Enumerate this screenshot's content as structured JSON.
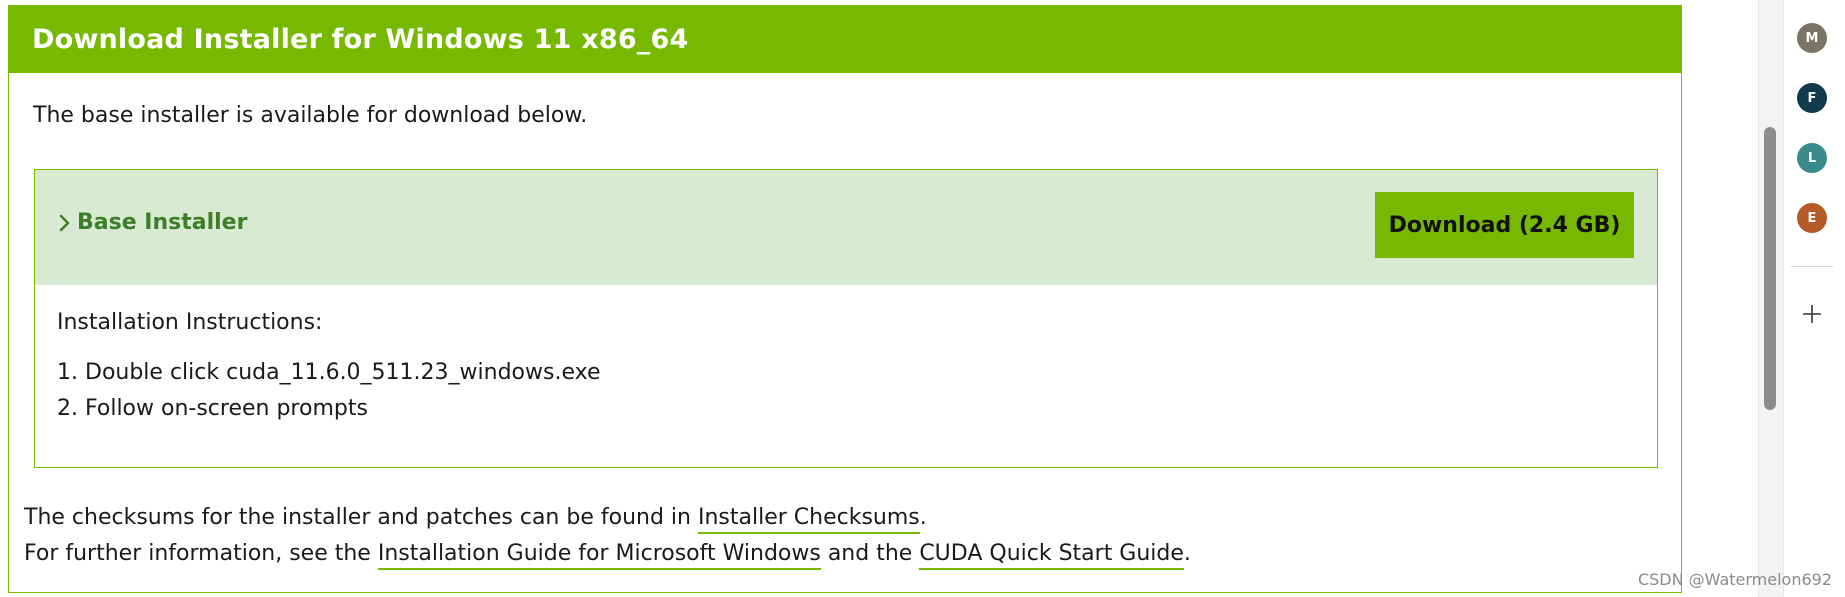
{
  "panel": {
    "title": "Download Installer for Windows 11 x86_64",
    "intro": "The base installer is available for download below."
  },
  "installer": {
    "label": "Base Installer",
    "download_label": "Download (2.4 GB)",
    "instructions_title": "Installation Instructions:",
    "steps": [
      "Double click cuda_11.6.0_511.23_windows.exe",
      "Follow on-screen prompts"
    ]
  },
  "footer": {
    "line1_prefix": "The checksums for the installer and patches can be found in ",
    "checksums_link": "Installer Checksums",
    "line1_suffix": ".",
    "line2_prefix": "For further information, see the ",
    "guide_link": "Installation Guide for Microsoft Windows",
    "line2_middle": " and the ",
    "quickstart_link": "CUDA Quick Start Guide",
    "line2_suffix": "."
  },
  "side_rail": {
    "avatars": [
      {
        "letter": "M",
        "color": "#7a7466"
      },
      {
        "letter": "F",
        "color": "#0f3b4c"
      },
      {
        "letter": "L",
        "color": "#3a8a8a"
      },
      {
        "letter": "E",
        "color": "#b45b27"
      }
    ]
  },
  "watermark": "CSDN @Watermelon692",
  "colors": {
    "brand_green": "#76b900",
    "header_bg": "#d8ebd2",
    "label_green": "#3e7d2a"
  }
}
